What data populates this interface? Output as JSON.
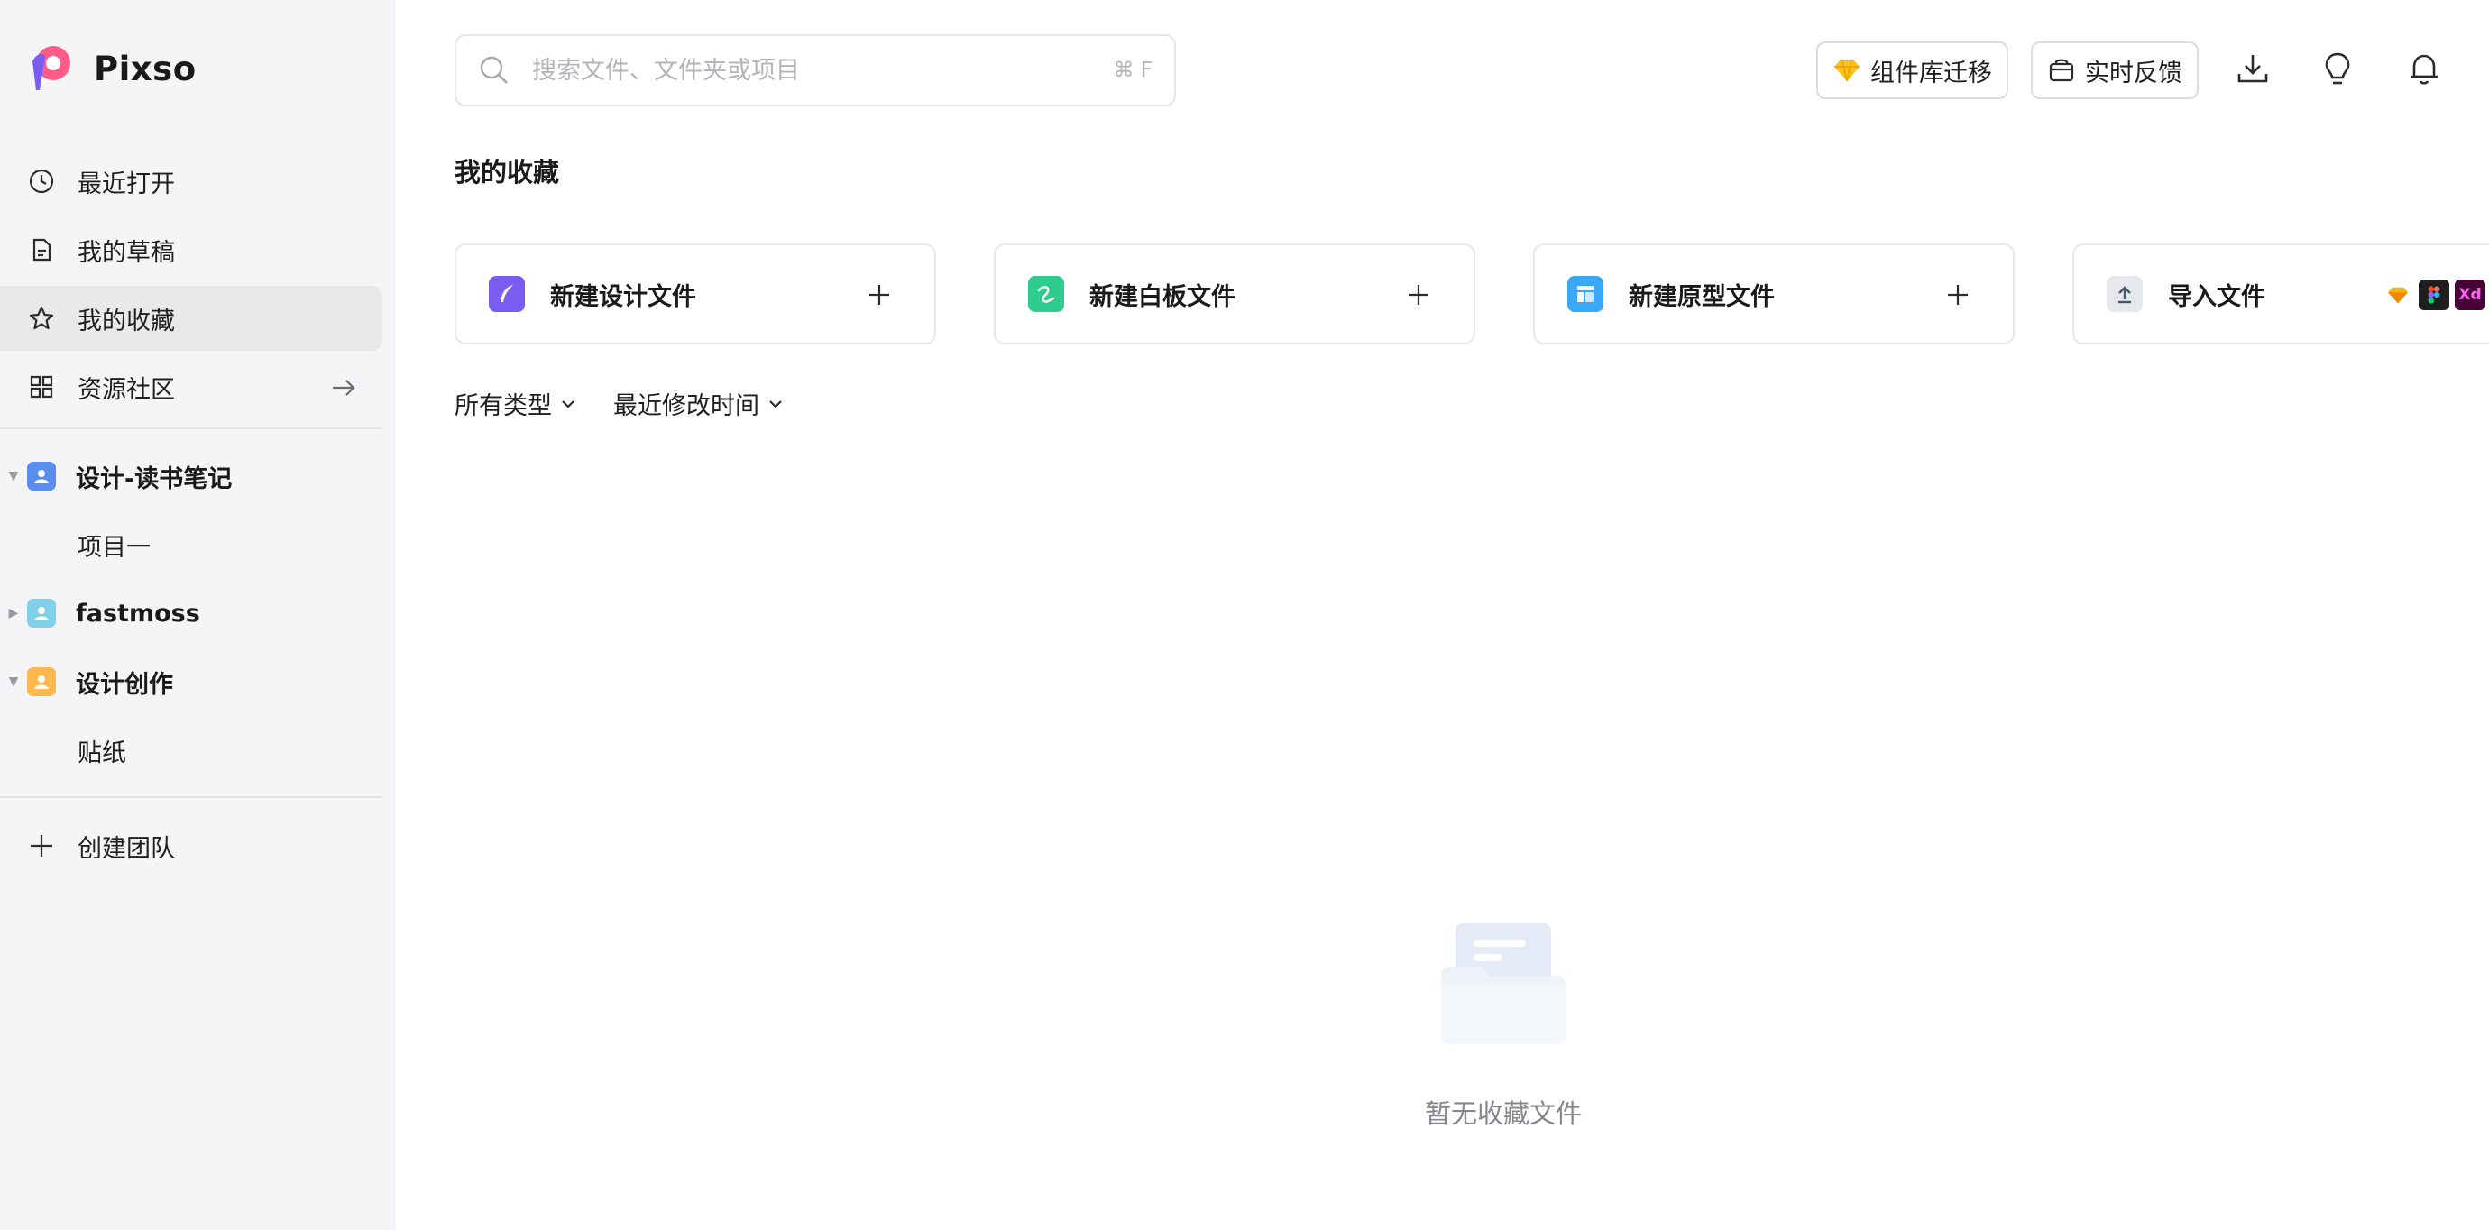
{
  "app": {
    "brand": "Pixso"
  },
  "sidebar": {
    "nav": [
      {
        "label": "最近打开",
        "icon": "clock-icon"
      },
      {
        "label": "我的草稿",
        "icon": "draft-icon"
      },
      {
        "label": "我的收藏",
        "icon": "star-icon",
        "active": true
      },
      {
        "label": "资源社区",
        "icon": "grid-icon"
      }
    ],
    "teams": [
      {
        "name": "设计-读书笔记",
        "color": "#5b8def",
        "expanded": true,
        "projects": [
          "项目一"
        ]
      },
      {
        "name": "fastmoss",
        "color": "#7fd0e8",
        "expanded": false,
        "projects": []
      },
      {
        "name": "设计创作",
        "color": "#ffb84d",
        "expanded": true,
        "projects": [
          "贴纸"
        ]
      }
    ],
    "create_team": "创建团队"
  },
  "header": {
    "search_placeholder": "搜索文件、文件夹或项目",
    "search_shortcut": "⌘ F",
    "migrate_label": "组件库迁移",
    "feedback_label": "实时反馈"
  },
  "main": {
    "section_title": "我的收藏",
    "cards": [
      {
        "label": "新建设计文件",
        "color": "#7b5cf0"
      },
      {
        "label": "新建白板文件",
        "color": "#2ecc8f"
      },
      {
        "label": "新建原型文件",
        "color": "#3aa8f5"
      },
      {
        "label": "导入文件",
        "color": "#e6e8ee"
      }
    ],
    "import_badges": [
      "sketch",
      "figma",
      "Xd"
    ],
    "filters": {
      "type": "所有类型",
      "sort": "最近修改时间"
    },
    "empty_text": "暂无收藏文件"
  }
}
